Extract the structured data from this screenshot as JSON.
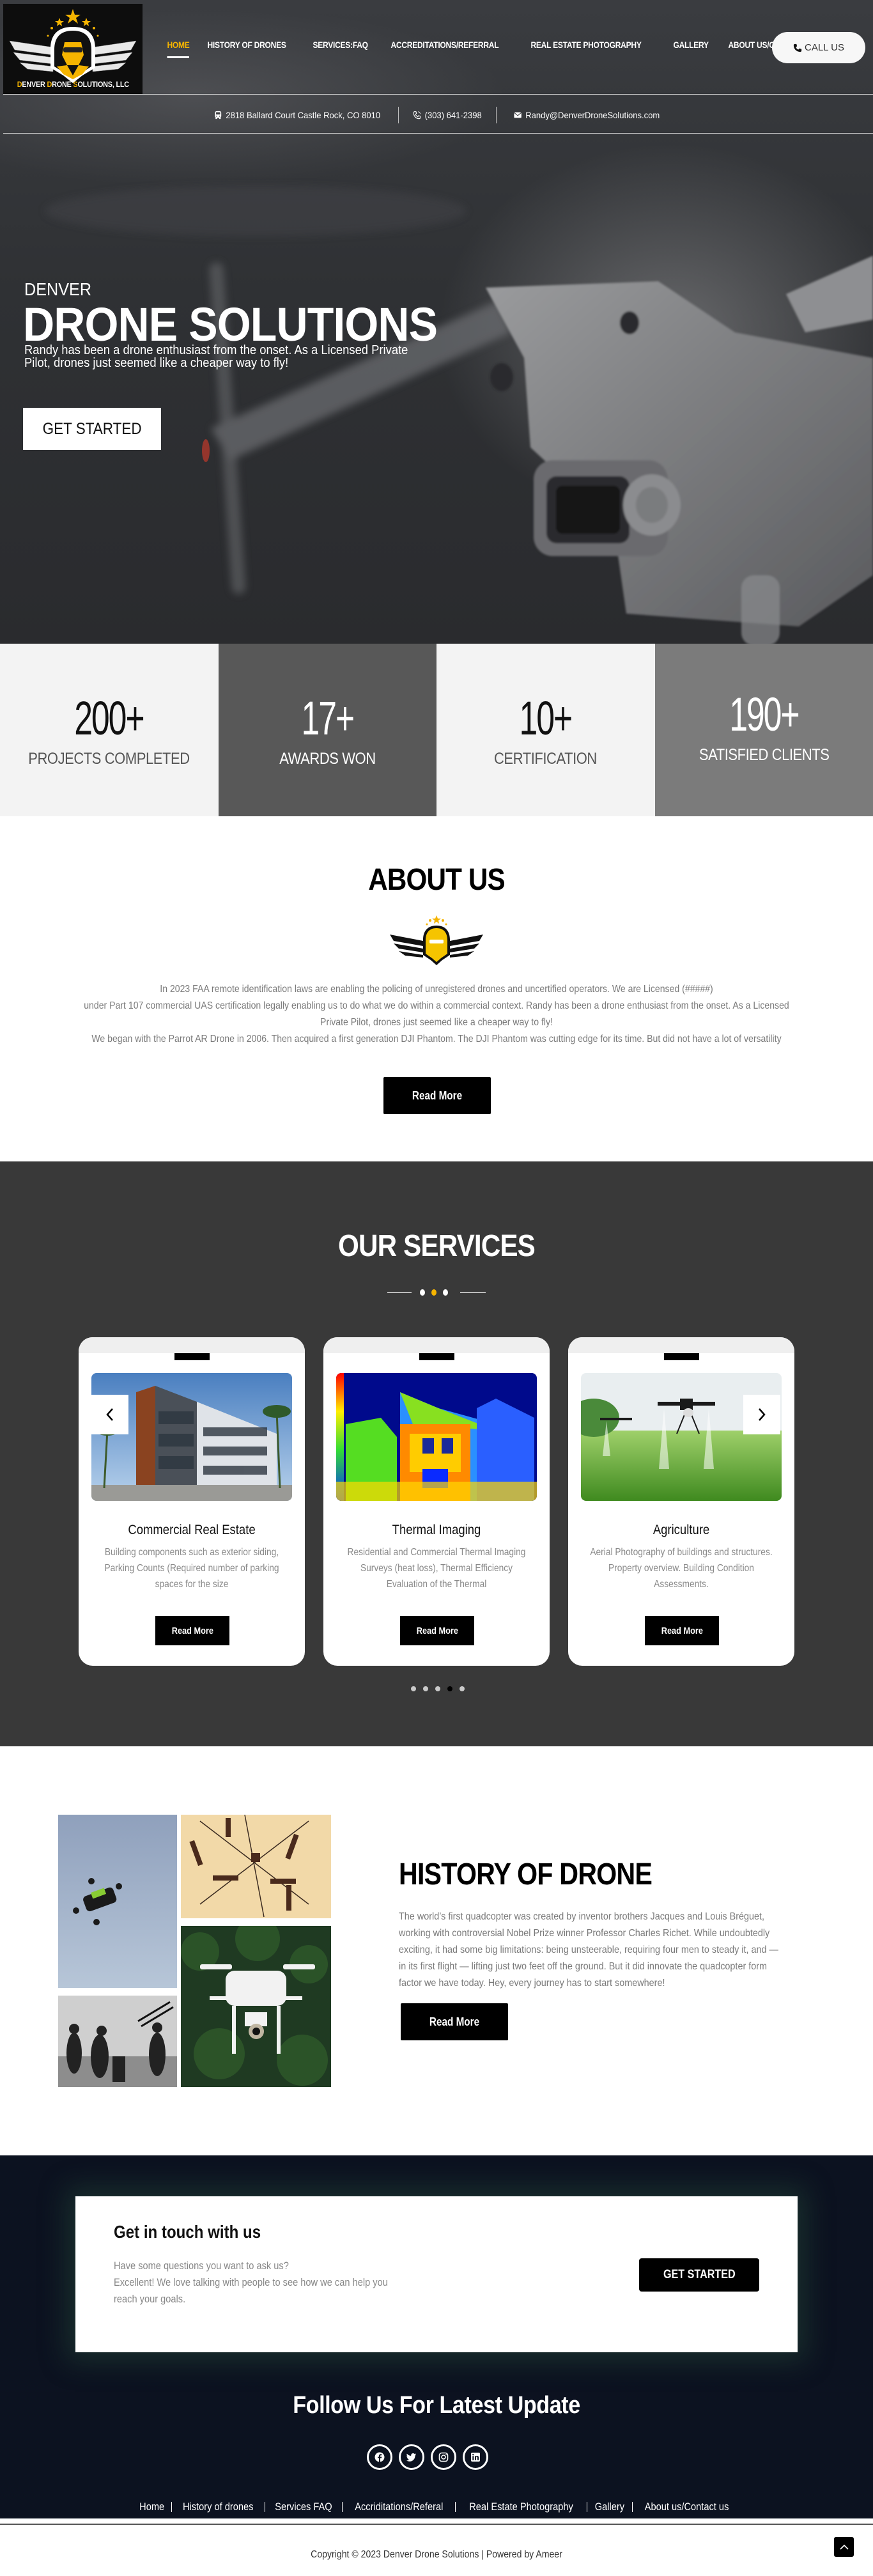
{
  "brand": {
    "logo_text_parts": [
      "D",
      "ENVER ",
      "D",
      "RONE ",
      "S",
      "OLUTIONS, LLC"
    ],
    "accent_color": "#f5b400"
  },
  "nav": {
    "items": [
      {
        "label": "HOME",
        "active": true
      },
      {
        "label": "HISTORY OF DRONES",
        "active": false
      },
      {
        "label": "SERVICES:FAQ",
        "active": false
      },
      {
        "label": "ACCREDITATIONS/REFERRAL",
        "active": false
      },
      {
        "label": "REAL ESTATE PHOTOGRAPHY",
        "active": false
      },
      {
        "label": "GALLERY",
        "active": false
      },
      {
        "label": "ABOUT US/CONTACT US",
        "active": false
      }
    ],
    "call_label": "CALL US"
  },
  "contact": {
    "address": "2818 Ballard Court Castle Rock, CO 8010",
    "phone": "(303) 641-2398",
    "email": "Randy@DenverDroneSolutions.com"
  },
  "hero": {
    "kicker": "DENVER",
    "title": "DRONE SOLUTIONS",
    "subtitle": "Randy has been a drone enthusiast from the onset. As a Licensed Private Pilot, drones just seemed like a cheaper way to fly!",
    "cta_label": "GET STARTED"
  },
  "stats": [
    {
      "value": "200+",
      "label": "PROJECTS COMPLETED"
    },
    {
      "value": "17+",
      "label": "AWARDS WON"
    },
    {
      "value": "10+",
      "label": "CERTIFICATION"
    },
    {
      "value": "190+",
      "label": "SATISFIED CLIENTS"
    }
  ],
  "about": {
    "title": "ABOUT US",
    "lines": [
      "In 2023 FAA remote identification laws are enabling the policing of unregistered drones and uncertified operators. We are Licensed (#####)",
      "under Part 107 commercial UAS certification legally enabling us to do what we do within a commercial context. Randy has been a drone enthusiast from the onset. As a Licensed",
      "Private Pilot, drones just seemed like a cheaper way to fly!",
      "We began with the Parrot AR Drone in 2006. Then acquired a first generation DJI Phantom. The DJI Phantom was cutting edge for its time. But did not have a lot of versatility"
    ],
    "button_label": "Read More"
  },
  "services": {
    "title": "OUR SERVICES",
    "cards": [
      {
        "title": "Commercial Real Estate",
        "description": "Building components such as exterior siding, Parking Counts (Required number of parking spaces for the size",
        "button_label": "Read More",
        "image": "commercial-building-photo"
      },
      {
        "title": "Thermal Imaging",
        "description": "Residential and Commercial Thermal Imaging Surveys (heat loss), Thermal Efficiency Evaluation of the Thermal",
        "button_label": "Read More",
        "image": "thermal-house-photo"
      },
      {
        "title": "Agriculture",
        "description": "Aerial Photography of buildings and structures. Property overview. Building Condition Assessments.",
        "button_label": "Read More",
        "image": "agri-drone-photo"
      }
    ],
    "carousel": {
      "total_pages": 5,
      "active_page": 4
    },
    "prev_icon": "chevron-left-icon",
    "next_icon": "chevron-right-icon"
  },
  "history": {
    "title": "HISTORY OF DRONE",
    "text": "The world’s first quadcopter was created by inventor brothers Jacques and Louis Bréguet, working with controversial Nobel Prize winner Professor Charles Richet. While undoubtedly exciting, it had some big limitations: being unsteerable, requiring four men to steady it, and — in its first flight — lifting just two feet off the ground. But it did innovate the quadcopter form factor we have today. Hey, every journey has to start somewhere!",
    "button_label": "Read More"
  },
  "cta": {
    "title": "Get in touch with us",
    "text_line1": "Have some questions you want to ask us?",
    "text_line2": "Excellent! We love talking with people to see how we can help you reach your goals.",
    "button_label": "GET STARTED"
  },
  "footer": {
    "follow_title": "Follow Us For Latest Update",
    "socials": [
      "facebook-icon",
      "twitter-icon",
      "instagram-icon",
      "linkedin-icon"
    ],
    "links": [
      "Home",
      "History of drones",
      "Services FAQ",
      "Accriditations/Referal",
      "Real Estate Photography",
      "Gallery",
      "About us/Contact us"
    ],
    "copyright": "Copyright © 2023 Denver Drone Solutions | Powered by Ameer"
  }
}
